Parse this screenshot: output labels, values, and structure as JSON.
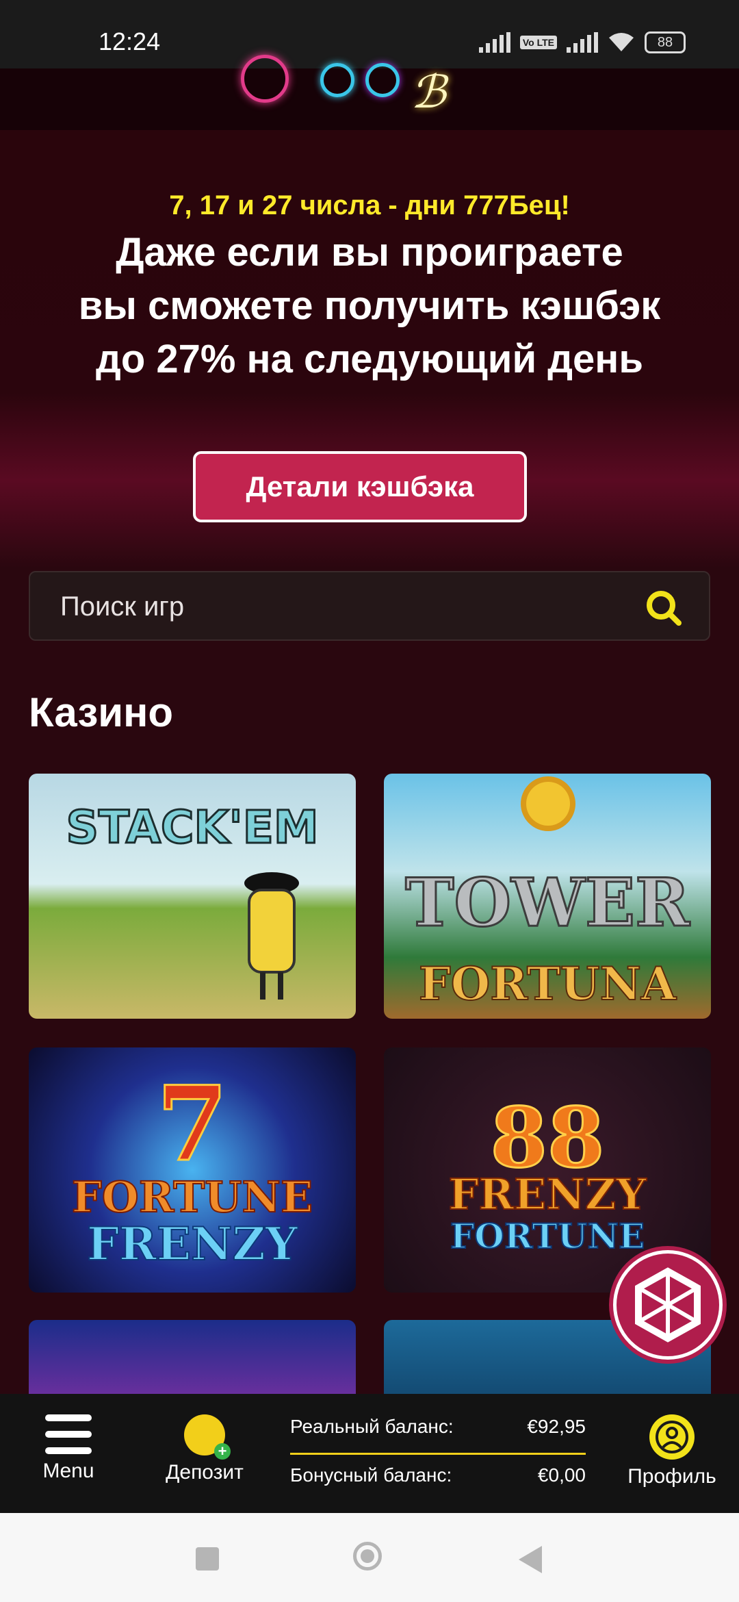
{
  "status_bar": {
    "time": "12:24",
    "volte": "Vo LTE",
    "battery": "88"
  },
  "promo": {
    "subtitle": "7, 17 и 27 числа - дни 777Бец!",
    "headline_line1": "Даже если вы проиграете",
    "headline_line2": "вы сможете получить кэшбэк",
    "headline_line3": "до 27% на следующий день",
    "button_label": "Детали кэшбэка"
  },
  "search": {
    "placeholder": "Поиск игр"
  },
  "section": {
    "title": "Казино"
  },
  "games": [
    {
      "title": "STACK'EM"
    },
    {
      "title_line1": "TOWER",
      "title_line2": "FORTUNA"
    },
    {
      "title_top": "7",
      "title_line1": "FORTUNE",
      "title_line2": "FRENZY"
    },
    {
      "title_top": "88",
      "title_line1": "FRENZY",
      "title_line2": "FORTUNE"
    }
  ],
  "bottom_nav": {
    "menu_label": "Menu",
    "deposit_label": "Депозит",
    "real_balance_label": "Реальный баланс:",
    "real_balance_value": "€92,95",
    "bonus_balance_label": "Бонусный баланс:",
    "bonus_balance_value": "€0,00",
    "profile_label": "Профиль"
  },
  "colors": {
    "accent": "#c2244f",
    "highlight": "#ffea2a",
    "background": "#2a070f",
    "coin": "#f2cf1a"
  }
}
